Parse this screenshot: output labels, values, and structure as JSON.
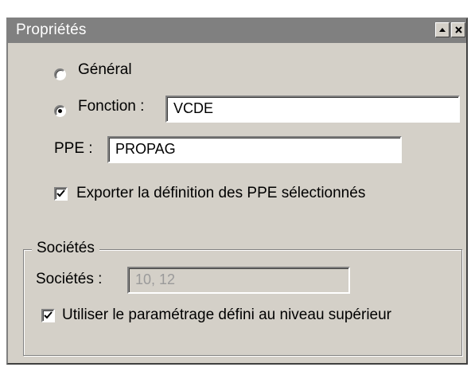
{
  "window": {
    "title": "Propriétés"
  },
  "options": {
    "general_label": "Général",
    "fonction_label": "Fonction :",
    "fonction_value": "VCDE",
    "ppe_label": "PPE :",
    "ppe_value": "PROPAG",
    "export_label": "Exporter la définition des PPE sélectionnés",
    "export_checked": true
  },
  "societes": {
    "group_title": "Sociétés",
    "field_label": "Sociétés :",
    "field_value": "10, 12",
    "inherit_label": "Utiliser le paramétrage défini au niveau supérieur",
    "inherit_checked": true
  }
}
